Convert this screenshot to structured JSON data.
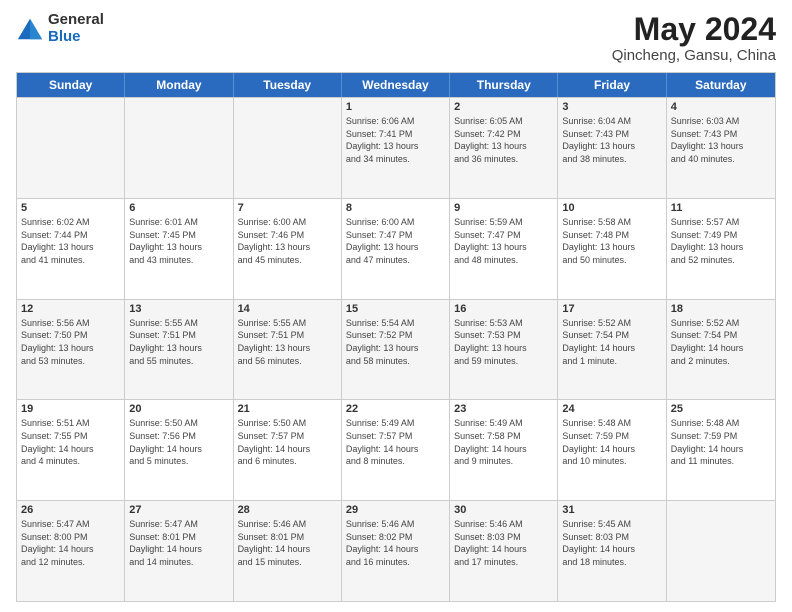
{
  "header": {
    "logo_general": "General",
    "logo_blue": "Blue",
    "title": "May 2024",
    "location": "Qincheng, Gansu, China"
  },
  "days": [
    "Sunday",
    "Monday",
    "Tuesday",
    "Wednesday",
    "Thursday",
    "Friday",
    "Saturday"
  ],
  "weeks": [
    [
      {
        "date": "",
        "info": ""
      },
      {
        "date": "",
        "info": ""
      },
      {
        "date": "",
        "info": ""
      },
      {
        "date": "1",
        "info": "Sunrise: 6:06 AM\nSunset: 7:41 PM\nDaylight: 13 hours\nand 34 minutes."
      },
      {
        "date": "2",
        "info": "Sunrise: 6:05 AM\nSunset: 7:42 PM\nDaylight: 13 hours\nand 36 minutes."
      },
      {
        "date": "3",
        "info": "Sunrise: 6:04 AM\nSunset: 7:43 PM\nDaylight: 13 hours\nand 38 minutes."
      },
      {
        "date": "4",
        "info": "Sunrise: 6:03 AM\nSunset: 7:43 PM\nDaylight: 13 hours\nand 40 minutes."
      }
    ],
    [
      {
        "date": "5",
        "info": "Sunrise: 6:02 AM\nSunset: 7:44 PM\nDaylight: 13 hours\nand 41 minutes."
      },
      {
        "date": "6",
        "info": "Sunrise: 6:01 AM\nSunset: 7:45 PM\nDaylight: 13 hours\nand 43 minutes."
      },
      {
        "date": "7",
        "info": "Sunrise: 6:00 AM\nSunset: 7:46 PM\nDaylight: 13 hours\nand 45 minutes."
      },
      {
        "date": "8",
        "info": "Sunrise: 6:00 AM\nSunset: 7:47 PM\nDaylight: 13 hours\nand 47 minutes."
      },
      {
        "date": "9",
        "info": "Sunrise: 5:59 AM\nSunset: 7:47 PM\nDaylight: 13 hours\nand 48 minutes."
      },
      {
        "date": "10",
        "info": "Sunrise: 5:58 AM\nSunset: 7:48 PM\nDaylight: 13 hours\nand 50 minutes."
      },
      {
        "date": "11",
        "info": "Sunrise: 5:57 AM\nSunset: 7:49 PM\nDaylight: 13 hours\nand 52 minutes."
      }
    ],
    [
      {
        "date": "12",
        "info": "Sunrise: 5:56 AM\nSunset: 7:50 PM\nDaylight: 13 hours\nand 53 minutes."
      },
      {
        "date": "13",
        "info": "Sunrise: 5:55 AM\nSunset: 7:51 PM\nDaylight: 13 hours\nand 55 minutes."
      },
      {
        "date": "14",
        "info": "Sunrise: 5:55 AM\nSunset: 7:51 PM\nDaylight: 13 hours\nand 56 minutes."
      },
      {
        "date": "15",
        "info": "Sunrise: 5:54 AM\nSunset: 7:52 PM\nDaylight: 13 hours\nand 58 minutes."
      },
      {
        "date": "16",
        "info": "Sunrise: 5:53 AM\nSunset: 7:53 PM\nDaylight: 13 hours\nand 59 minutes."
      },
      {
        "date": "17",
        "info": "Sunrise: 5:52 AM\nSunset: 7:54 PM\nDaylight: 14 hours\nand 1 minute."
      },
      {
        "date": "18",
        "info": "Sunrise: 5:52 AM\nSunset: 7:54 PM\nDaylight: 14 hours\nand 2 minutes."
      }
    ],
    [
      {
        "date": "19",
        "info": "Sunrise: 5:51 AM\nSunset: 7:55 PM\nDaylight: 14 hours\nand 4 minutes."
      },
      {
        "date": "20",
        "info": "Sunrise: 5:50 AM\nSunset: 7:56 PM\nDaylight: 14 hours\nand 5 minutes."
      },
      {
        "date": "21",
        "info": "Sunrise: 5:50 AM\nSunset: 7:57 PM\nDaylight: 14 hours\nand 6 minutes."
      },
      {
        "date": "22",
        "info": "Sunrise: 5:49 AM\nSunset: 7:57 PM\nDaylight: 14 hours\nand 8 minutes."
      },
      {
        "date": "23",
        "info": "Sunrise: 5:49 AM\nSunset: 7:58 PM\nDaylight: 14 hours\nand 9 minutes."
      },
      {
        "date": "24",
        "info": "Sunrise: 5:48 AM\nSunset: 7:59 PM\nDaylight: 14 hours\nand 10 minutes."
      },
      {
        "date": "25",
        "info": "Sunrise: 5:48 AM\nSunset: 7:59 PM\nDaylight: 14 hours\nand 11 minutes."
      }
    ],
    [
      {
        "date": "26",
        "info": "Sunrise: 5:47 AM\nSunset: 8:00 PM\nDaylight: 14 hours\nand 12 minutes."
      },
      {
        "date": "27",
        "info": "Sunrise: 5:47 AM\nSunset: 8:01 PM\nDaylight: 14 hours\nand 14 minutes."
      },
      {
        "date": "28",
        "info": "Sunrise: 5:46 AM\nSunset: 8:01 PM\nDaylight: 14 hours\nand 15 minutes."
      },
      {
        "date": "29",
        "info": "Sunrise: 5:46 AM\nSunset: 8:02 PM\nDaylight: 14 hours\nand 16 minutes."
      },
      {
        "date": "30",
        "info": "Sunrise: 5:46 AM\nSunset: 8:03 PM\nDaylight: 14 hours\nand 17 minutes."
      },
      {
        "date": "31",
        "info": "Sunrise: 5:45 AM\nSunset: 8:03 PM\nDaylight: 14 hours\nand 18 minutes."
      },
      {
        "date": "",
        "info": ""
      }
    ]
  ]
}
